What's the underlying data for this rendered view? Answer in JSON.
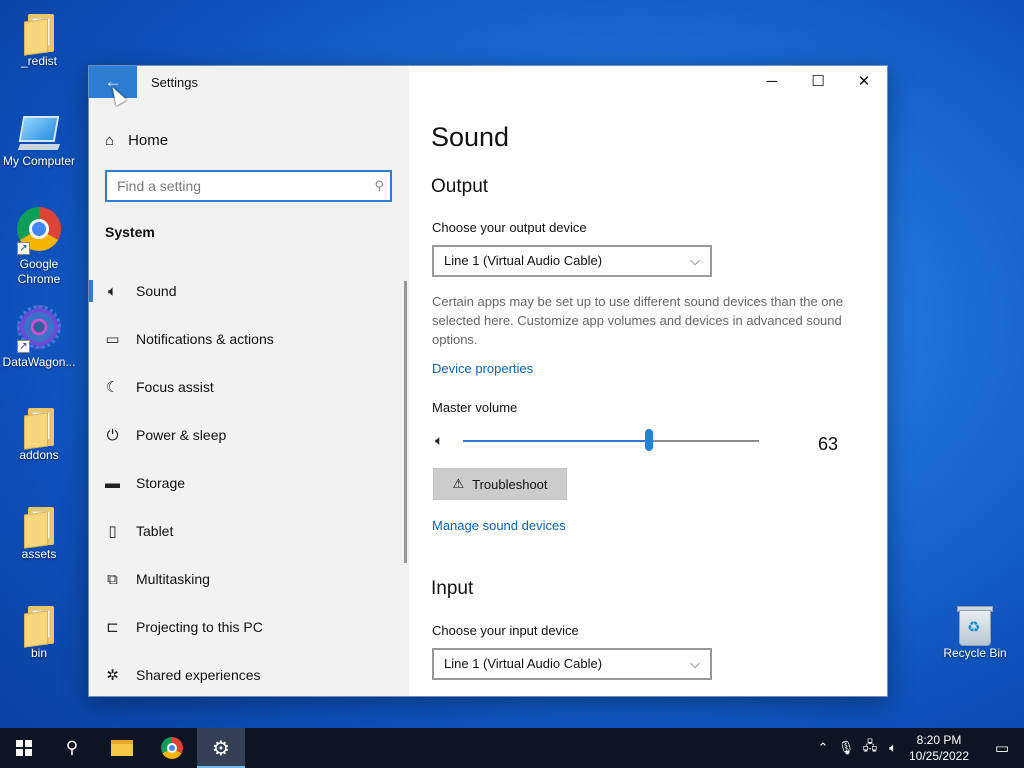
{
  "desktop": {
    "icons": [
      {
        "label": "_redist"
      },
      {
        "label": "My Computer"
      },
      {
        "label": "Google Chrome"
      },
      {
        "label": "DataWagon..."
      },
      {
        "label": "addons"
      },
      {
        "label": "assets"
      },
      {
        "label": "bin"
      },
      {
        "label": "Recycle Bin"
      }
    ]
  },
  "window": {
    "title": "Settings",
    "back_icon": "arrow-left-icon",
    "controls": {
      "minimize": "─",
      "maximize": "☐",
      "close": "✕"
    }
  },
  "sidebar": {
    "home_label": "Home",
    "search_placeholder": "Find a setting",
    "section_label": "System",
    "items": [
      {
        "label": "Sound",
        "icon": "speaker-icon",
        "glyph": "🔈︎",
        "active": true
      },
      {
        "label": "Notifications & actions",
        "icon": "notification-icon",
        "glyph": "▭",
        "active": false
      },
      {
        "label": "Focus assist",
        "icon": "moon-icon",
        "glyph": "☾",
        "active": false
      },
      {
        "label": "Power & sleep",
        "icon": "power-icon",
        "glyph": "⏻",
        "active": false
      },
      {
        "label": "Storage",
        "icon": "storage-icon",
        "glyph": "▬",
        "active": false
      },
      {
        "label": "Tablet",
        "icon": "tablet-icon",
        "glyph": "▯",
        "active": false
      },
      {
        "label": "Multitasking",
        "icon": "multitasking-icon",
        "glyph": "⧉",
        "active": false
      },
      {
        "label": "Projecting to this PC",
        "icon": "projector-icon",
        "glyph": "⊏",
        "active": false
      },
      {
        "label": "Shared experiences",
        "icon": "share-icon",
        "glyph": "✲",
        "active": false
      }
    ]
  },
  "content": {
    "page_title": "Sound",
    "output": {
      "heading": "Output",
      "device_label": "Choose your output device",
      "device_value": "Line 1 (Virtual Audio Cable)",
      "description": "Certain apps may be set up to use different sound devices than the one selected here. Customize app volumes and devices in advanced sound options.",
      "device_properties_link": "Device properties",
      "master_volume_label": "Master volume",
      "master_volume_value": "63",
      "volume_level": 0.63,
      "troubleshoot_label": "Troubleshoot",
      "manage_link": "Manage sound devices"
    },
    "input": {
      "heading": "Input",
      "device_label": "Choose your input device",
      "device_value": "Line 1 (Virtual Audio Cable)"
    }
  },
  "taskbar": {
    "clock_time": "8:20 PM",
    "clock_date": "10/25/2022",
    "accent": "#76b9ed"
  },
  "colors": {
    "accent": "#2d7dd2",
    "link": "#0a64b8"
  }
}
